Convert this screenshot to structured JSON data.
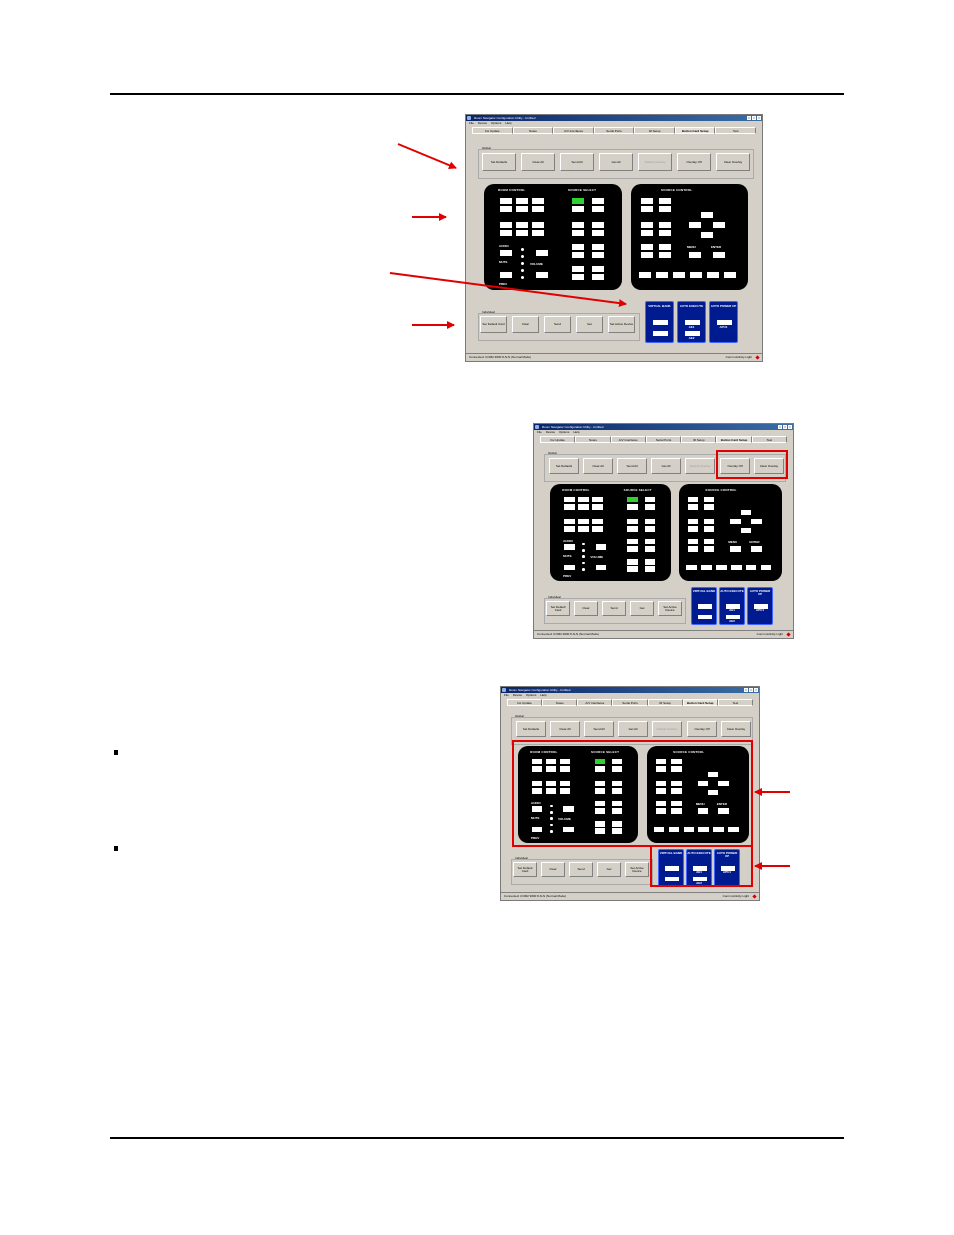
{
  "app": {
    "title": "Room Navigator Configuration Utility - Untitled",
    "menu": [
      "File",
      "Device",
      "Options",
      "Help"
    ],
    "tabs": [
      "Fw Update",
      "Notes",
      "A/V Interfaces",
      "Serial Ports",
      "IR Setup",
      "Button Card Setup",
      "Test"
    ],
    "active_tab": "Button Card Setup",
    "global_label": "Global",
    "global_buttons": [
      "Set Defaults",
      "Clear All",
      "Send All",
      "Get All",
      "Default Overlay",
      "Overlay Off",
      "Clear Overlay"
    ],
    "individual_label": "Individual",
    "individual_buttons": [
      "Set Default Card",
      "Clear",
      "Send",
      "Get",
      "Set Active Device"
    ],
    "room_control_title": "ROOM CONTROL",
    "source_select_title": "SOURCE SELECT",
    "source_control_title": "SOURCE CONTROL",
    "room_labels": {
      "audio": "AUDIO",
      "mute": "MUTE",
      "volume": "VOLUME",
      "prev": "PREV"
    },
    "source_labels": {
      "menu": "MENU",
      "enter": "ENTER"
    },
    "blue_panels": {
      "virtual_bank": "VIRTUAL BANK",
      "auto_execute": "AUTO EXECUTE",
      "auto_powerup": "AUTO POWER UP",
      "ae1": "AE1",
      "ae2": "AE2",
      "apu1": "APU1"
    },
    "status_left": "Connected: COM2 9600 8-N-N (Normal Mode)",
    "status_right": "Comm Activity Light"
  },
  "colors": {
    "accent_red": "#e00000",
    "panel_black": "#000000",
    "panel_blue": "#001a8f",
    "selected_green": "#2fd02f"
  }
}
